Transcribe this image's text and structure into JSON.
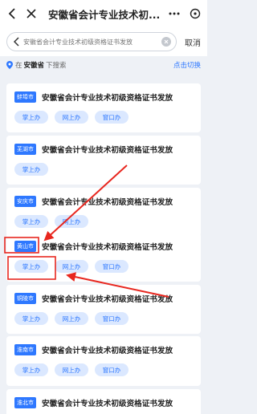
{
  "header": {
    "title": "安徽省会计专业技术初..."
  },
  "search": {
    "placeholder": "安徽省会计专业技术初级资格证书发放",
    "cancel_label": "取消"
  },
  "location": {
    "prefix": "在",
    "region": "安徽省",
    "suffix": "下搜索",
    "switch_label": "点击切换"
  },
  "items": [
    {
      "city": "蚌埠市",
      "name": "安徽省会计专业技术初级资格证书发放",
      "services": [
        "掌上办",
        "网上办",
        "窗口办"
      ]
    },
    {
      "city": "芜湖市",
      "name": "安徽省会计专业技术初级资格证书发放",
      "services": [
        "掌上办"
      ]
    },
    {
      "city": "安庆市",
      "name": "安徽省会计专业技术初级资格证书发放",
      "services": [
        "掌上办",
        "网上办"
      ]
    },
    {
      "city": "黄山市",
      "name": "安徽省会计专业技术初级资格证书发放",
      "services": [
        "掌上办",
        "网上办",
        "窗口办"
      ]
    },
    {
      "city": "铜陵市",
      "name": "安徽省会计专业技术初级资格证书发放",
      "services": [
        "掌上办",
        "网上办",
        "窗口办"
      ]
    },
    {
      "city": "淮南市",
      "name": "安徽省会计专业技术初级资格证书发放",
      "services": [
        "掌上办",
        "网上办",
        "窗口办"
      ]
    },
    {
      "city": "淮北市",
      "name": "安徽省会计专业技术初级资格证书发放",
      "services": []
    }
  ],
  "colors": {
    "accent": "#2e78ff",
    "annotation": "#e8271f",
    "chip_bg": "#dbe8ff"
  }
}
